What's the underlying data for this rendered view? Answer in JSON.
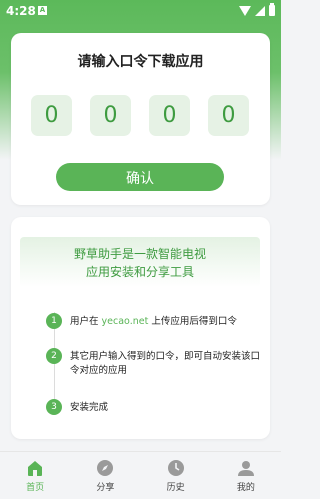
{
  "status": {
    "time": "4:28",
    "app_badge": "A"
  },
  "code_card": {
    "title": "请输入口令下载应用",
    "digits": [
      "0",
      "0",
      "0",
      "0"
    ],
    "confirm_label": "确认"
  },
  "intro": {
    "line1": "野草助手是一款智能电视",
    "line2": "应用安装和分享工具"
  },
  "steps": [
    {
      "num": "1",
      "prefix": "用户在 ",
      "highlight": "yecao.net",
      "suffix": " 上传应用后得到口令"
    },
    {
      "num": "2",
      "text": "其它用户输入得到的口令，即可自动安装该口令对应的应用"
    },
    {
      "num": "3",
      "text": "安装完成"
    }
  ],
  "nav": {
    "items": [
      {
        "label": "首页",
        "icon": "home-icon",
        "active": true
      },
      {
        "label": "分享",
        "icon": "compass-icon",
        "active": false
      },
      {
        "label": "历史",
        "icon": "clock-icon",
        "active": false
      },
      {
        "label": "我的",
        "icon": "person-icon",
        "active": false
      }
    ]
  },
  "colors": {
    "accent": "#5ab457",
    "accent_dark": "#3e9b40",
    "code_box_bg": "#e6f2e5"
  }
}
